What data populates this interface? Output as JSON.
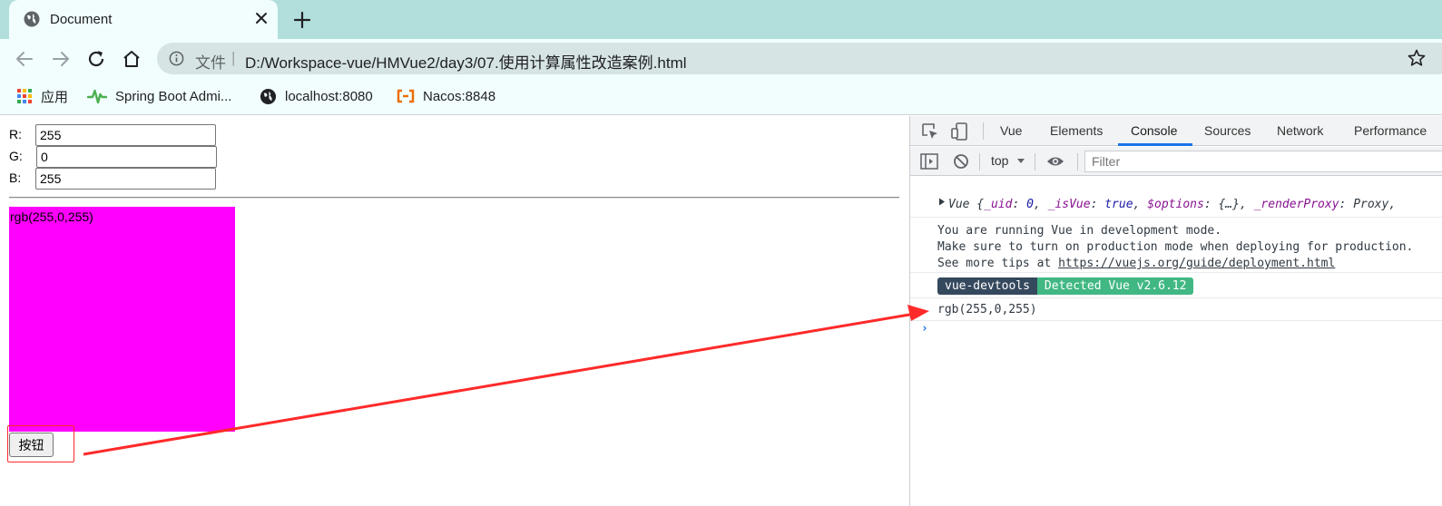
{
  "browser": {
    "tab_title": "Document",
    "address": {
      "scheme_label": "文件",
      "separator": "|",
      "url": "D:/Workspace-vue/HMVue2/day3/07.使用计算属性改造案例.html"
    },
    "bookmarks": [
      {
        "label": "应用",
        "icon": "apps-grid-icon"
      },
      {
        "label": "Spring Boot Admi...",
        "icon": "spring-boot-pulse-icon"
      },
      {
        "label": "localhost:8080",
        "icon": "globe-icon"
      },
      {
        "label": "Nacos:8848",
        "icon": "nacos-icon"
      }
    ]
  },
  "page": {
    "inputs": [
      {
        "label": "R:",
        "value": "255"
      },
      {
        "label": "G:",
        "value": "0"
      },
      {
        "label": "B:",
        "value": "255"
      }
    ],
    "color_box": {
      "text": "rgb(255,0,255)",
      "color": "#ff00ff"
    },
    "button_label": "按钮"
  },
  "devtools": {
    "tabs": [
      "Vue",
      "Elements",
      "Console",
      "Sources",
      "Network",
      "Performance"
    ],
    "active_tab": "Console",
    "context": "top",
    "filter_placeholder": "Filter",
    "console": {
      "vue_obj_prefix": "Vue {",
      "vue_obj_fields": [
        {
          "key": "_uid",
          "value": "0"
        },
        {
          "key": "_isVue",
          "value": "true"
        },
        {
          "key": "$options",
          "value": "{…}"
        },
        {
          "key": "_renderProxy",
          "value": "Proxy"
        }
      ],
      "dev_mode_lines": [
        "You are running Vue in development mode.",
        "Make sure to turn on production mode when deploying for production."
      ],
      "tips_prefix": "See more tips at ",
      "tips_link": "https://vuejs.org/guide/deployment.html",
      "badge_name": "vue-devtools",
      "badge_detected": "Detected Vue v2.6.12",
      "log_output": "rgb(255,0,255)"
    }
  },
  "colors": {
    "tabstrip": "#b2dfdb",
    "toolbar": "#f1fefd",
    "annotation": "#ff2a2a",
    "active_tab_underline": "#1a73e8"
  }
}
